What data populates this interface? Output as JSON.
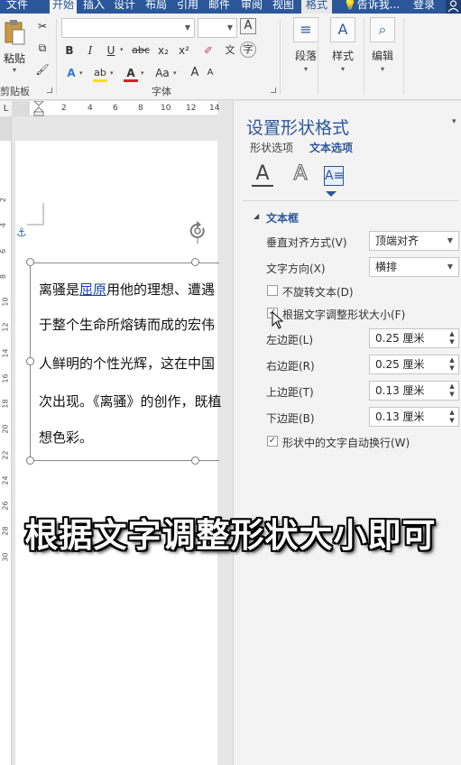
{
  "tabs": [
    "文件",
    "开始",
    "插入",
    "设计",
    "布局",
    "引用",
    "邮件",
    "审阅",
    "视图",
    "格式"
  ],
  "active_tab": "开始",
  "tell_me": "告诉我...",
  "login": "登录",
  "ribbon": {
    "clipboard": {
      "paste_label": "粘贴",
      "group_label": "剪贴板"
    },
    "font": {
      "group_label": "字体",
      "font_name": "",
      "font_size": "",
      "bold": "B",
      "italic": "I",
      "underline": "U",
      "strikethrough": "abc",
      "subscript": "x₂",
      "superscript": "x²",
      "text_effects": "A",
      "highlight": "ab",
      "font_color": "A",
      "change_case": "Aa",
      "phonetic": "A",
      "border_char": "字",
      "grow": "A",
      "shrink": "A",
      "font_color_hex": "#d92020",
      "highlight_hex": "#ffe000"
    },
    "paragraph": {
      "label": "段落"
    },
    "styles": {
      "label": "样式"
    },
    "editing": {
      "label": "编辑"
    }
  },
  "ruler": {
    "marks": [
      "2",
      "4",
      "6",
      "8",
      "10",
      "12",
      "14"
    ],
    "corner": "L"
  },
  "vruler": {
    "marks": [
      "2",
      "4",
      "6",
      "8",
      "10",
      "12",
      "14",
      "16",
      "18",
      "20",
      "22",
      "24",
      "26",
      "28",
      "30"
    ]
  },
  "document": {
    "line1_prefix": "离骚是",
    "line1_link": "屈原",
    "line1_suffix": "用他的理想、遭遇",
    "line2": "于整个生命所熔铸而成的宏伟",
    "line3": "人鲜明的个性光辉，这在中国",
    "line4": "次出现。《离骚》的创作，既植",
    "line5": "想色彩。"
  },
  "pane": {
    "title": "设置形状格式",
    "tabs": [
      "形状选项",
      "文本选项"
    ],
    "active_tab": "文本选项",
    "section": "文本框",
    "vertical_align_label": "垂直对齐方式(V)",
    "vertical_align_value": "顶端对齐",
    "text_direction_label": "文字方向(X)",
    "text_direction_value": "横排",
    "no_rotate_label": "不旋转文本(D)",
    "no_rotate_checked": false,
    "resize_label": "根据文字调整形状大小(F)",
    "resize_checked": true,
    "left_margin_label": "左边距(L)",
    "left_margin_value": "0.25 厘米",
    "right_margin_label": "右边距(R)",
    "right_margin_value": "0.25 厘米",
    "top_margin_label": "上边距(T)",
    "top_margin_value": "0.13 厘米",
    "bottom_margin_label": "下边距(B)",
    "bottom_margin_value": "0.13 厘米",
    "wrap_label": "形状中的文字自动换行(W)",
    "wrap_checked": true,
    "accent_hex": "#2b579a"
  },
  "caption": "根据文字调整形状大小即可"
}
